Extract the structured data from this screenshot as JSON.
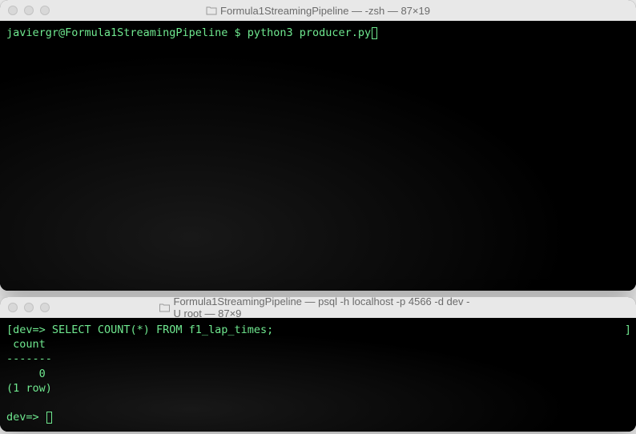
{
  "window1": {
    "title": "Formula1StreamingPipeline — -zsh — 87×19",
    "prompt": "javiergr@Formula1StreamingPipeline $ ",
    "command": "python3 producer.py"
  },
  "window2": {
    "title": "Formula1StreamingPipeline — psql -h localhost -p 4566 -d dev -U root — 87×9",
    "prompt1_bracket": "[",
    "prompt1": "dev=> ",
    "query": "SELECT COUNT(*) FROM f1_lap_times;",
    "right_bracket": "]",
    "output_header": " count ",
    "output_divider": "-------",
    "output_value": "     0",
    "output_footer": "(1 row)",
    "blank": "",
    "prompt2": "dev=> "
  }
}
